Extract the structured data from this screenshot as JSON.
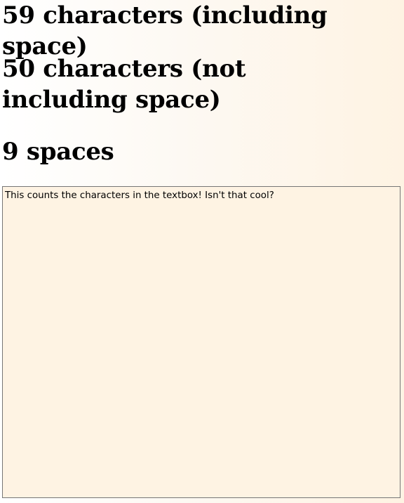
{
  "counter": {
    "total_label": "59 characters (including space)",
    "no_space_label": "50 characters (not including space)",
    "spaces_label": "9 spaces"
  },
  "textbox": {
    "value": "This counts the characters in the textbox! Isn't that cool?"
  },
  "colors": {
    "page_gradient_start": "#ffffff",
    "page_gradient_end": "#fef3e3",
    "textbox_background": "#fef3e3",
    "textbox_border": "#767676",
    "text": "#000000"
  }
}
